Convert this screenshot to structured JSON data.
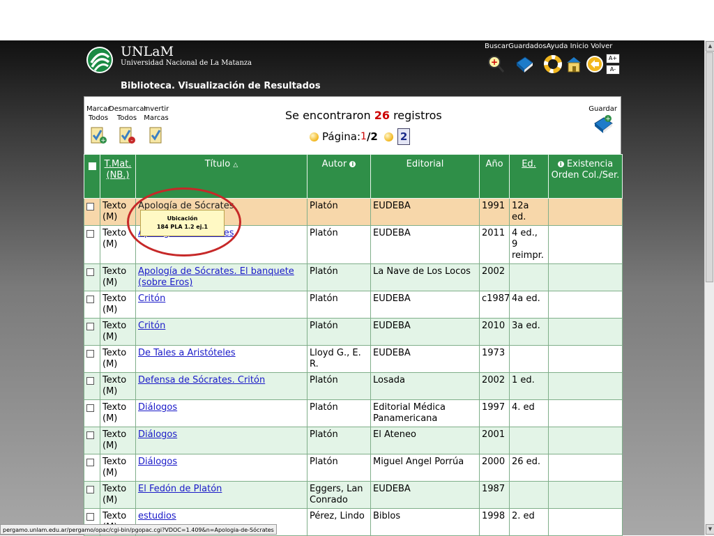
{
  "header": {
    "brand_name": "UNLaM",
    "brand_subtitle": "Universidad Nacional de La Matanza",
    "library_title": "Biblioteca. Visualización de Resultados",
    "nav": [
      "Buscar",
      "Guardados",
      "Ayuda",
      "Inicio",
      "Volver"
    ],
    "font_larger": "A+",
    "font_smaller": "A-"
  },
  "toolbar": {
    "mark_all": [
      "Marcar",
      "Todos"
    ],
    "unmark_all": [
      "Desmarcar",
      "Todos"
    ],
    "invert_marks": [
      "Invertir",
      "Marcas"
    ],
    "results_prefix": "Se encontraron",
    "results_count": "26",
    "results_suffix": "registros",
    "page_label": "Página:",
    "current_page": "1",
    "total_pages": "/2",
    "next_page": "2",
    "save_label": "Guardar"
  },
  "table": {
    "headers": {
      "t_mat": "T.Mat.",
      "nb": "(NB.)",
      "titulo": "Título",
      "autor": "Autor",
      "editorial": "Editorial",
      "anio": "Año",
      "ed": "Ed.",
      "existencia": "Existencia",
      "orden": "Orden Col./Ser."
    },
    "rows": [
      {
        "tipo": "Texto",
        "nb": "(M)",
        "titulo": "Apología de Sócrates",
        "autor": "Platón",
        "editorial": "EUDEBA",
        "anio": "1991",
        "ed": "12a ed."
      },
      {
        "tipo": "Texto",
        "nb": "(M)",
        "titulo": "Apología de Sócrates",
        "autor": "Platón",
        "editorial": "EUDEBA",
        "anio": "2011",
        "ed": "4 ed., 9 reimpr."
      },
      {
        "tipo": "Texto",
        "nb": "(M)",
        "titulo": "Apología de Sócrates. El banquete (sobre Eros)",
        "autor": "Platón",
        "editorial": "La Nave de Los Locos",
        "anio": "2002",
        "ed": ""
      },
      {
        "tipo": "Texto",
        "nb": "(M)",
        "titulo": "Critón",
        "autor": "Platón",
        "editorial": "EUDEBA",
        "anio": "c1987",
        "ed": "4a ed."
      },
      {
        "tipo": "Texto",
        "nb": "(M)",
        "titulo": "Critón",
        "autor": "Platón",
        "editorial": "EUDEBA",
        "anio": "2010",
        "ed": "3a ed."
      },
      {
        "tipo": "Texto",
        "nb": "(M)",
        "titulo": "De Tales a Aristóteles",
        "autor": "Lloyd G., E. R.",
        "editorial": "EUDEBA",
        "anio": "1973",
        "ed": ""
      },
      {
        "tipo": "Texto",
        "nb": "(M)",
        "titulo": "Defensa de Sócrates. Critón",
        "autor": "Platón",
        "editorial": "Losada",
        "anio": "2002",
        "ed": "1 ed."
      },
      {
        "tipo": "Texto",
        "nb": "(M)",
        "titulo": "Diálogos",
        "autor": "Platón",
        "editorial": "Editorial Médica Panamericana",
        "anio": "1997",
        "ed": "4. ed"
      },
      {
        "tipo": "Texto",
        "nb": "(M)",
        "titulo": "Diálogos",
        "autor": "Platón",
        "editorial": "El Ateneo",
        "anio": "2001",
        "ed": ""
      },
      {
        "tipo": "Texto",
        "nb": "(M)",
        "titulo": "Diálogos",
        "autor": "Platón",
        "editorial": "Miguel Angel Porrúa",
        "anio": "2000",
        "ed": "26 ed."
      },
      {
        "tipo": "Texto",
        "nb": "(M)",
        "titulo": "El Fedón de Platón",
        "autor": "Eggers, Lan Conrado",
        "editorial": "EUDEBA",
        "anio": "1987",
        "ed": ""
      },
      {
        "tipo": "Texto",
        "nb": "(M)",
        "titulo": "estudios",
        "autor": "Pérez, Lindo",
        "editorial": "Biblos",
        "anio": "1998",
        "ed": "2. ed"
      }
    ]
  },
  "tooltip": {
    "title": "Ubicación",
    "value": "184 PLA 1.2 ej.1"
  },
  "status_bar": {
    "url": "pergamo.unlam.edu.ar/pergamo/opac/cgi-bin/pgopac.cgi?VDOC=1.409&n=Apologia-de-Sócrates"
  },
  "colors": {
    "header_green": "#2f8f48",
    "highlight_row": "#f7d7aa",
    "alt_row": "#e3f4e7",
    "count_red": "#cc0000",
    "annotation_ring": "#c62828"
  }
}
